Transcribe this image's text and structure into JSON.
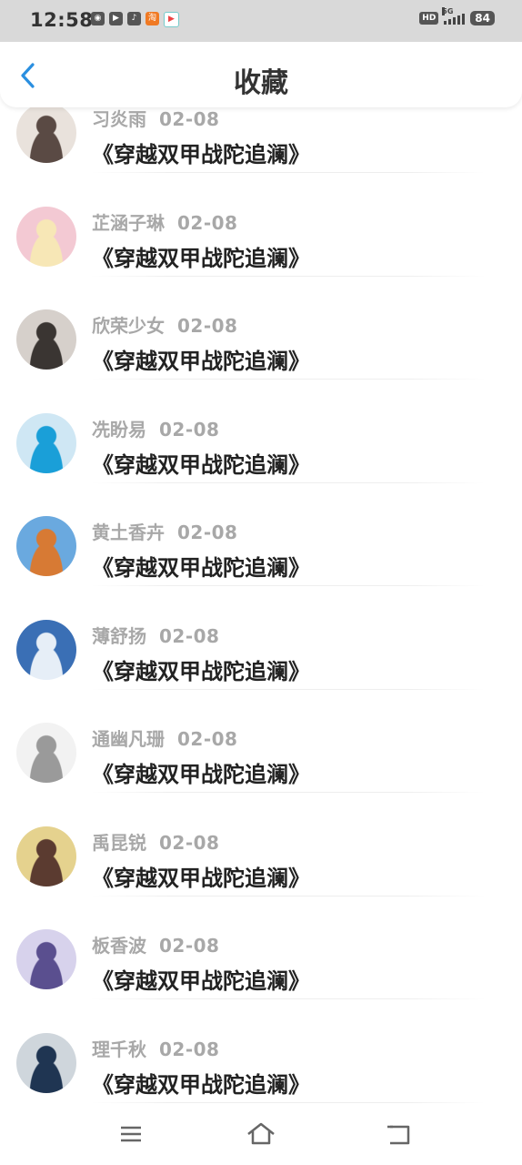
{
  "status_bar": {
    "time": "12:58",
    "app_icons": [
      "weibo-icon",
      "video-icon",
      "tiktok-icon",
      "taobao-icon",
      "play-icon"
    ],
    "hd_label": "HD",
    "network": "5G",
    "battery": "84"
  },
  "header": {
    "title": "收藏",
    "back_icon": "chevron-left-icon"
  },
  "items": [
    {
      "name": "习炎雨",
      "date": "02-08",
      "title": "《穿越双甲战陀追澜》",
      "avatar_colors": [
        "#e9e2dc",
        "#5a4a44"
      ]
    },
    {
      "name": "芷涵子琳",
      "date": "02-08",
      "title": "《穿越双甲战陀追澜》",
      "avatar_colors": [
        "#f3c9d3",
        "#f7e7b6"
      ]
    },
    {
      "name": "欣荣少女",
      "date": "02-08",
      "title": "《穿越双甲战陀追澜》",
      "avatar_colors": [
        "#d6d0cb",
        "#3a3532"
      ]
    },
    {
      "name": "冼盼易",
      "date": "02-08",
      "title": "《穿越双甲战陀追澜》",
      "avatar_colors": [
        "#cfe7f4",
        "#1a9fd8"
      ]
    },
    {
      "name": "黄土香卉",
      "date": "02-08",
      "title": "《穿越双甲战陀追澜》",
      "avatar_colors": [
        "#6aa9df",
        "#d77a34"
      ]
    },
    {
      "name": "薄舒扬",
      "date": "02-08",
      "title": "《穿越双甲战陀追澜》",
      "avatar_colors": [
        "#3a6fb5",
        "#e6eef7"
      ]
    },
    {
      "name": "通幽凡珊",
      "date": "02-08",
      "title": "《穿越双甲战陀追澜》",
      "avatar_colors": [
        "#f2f2f2",
        "#9a9a9a"
      ]
    },
    {
      "name": "禹昆锐",
      "date": "02-08",
      "title": "《穿越双甲战陀追澜》",
      "avatar_colors": [
        "#e5d28e",
        "#5b3b30"
      ]
    },
    {
      "name": "板香波",
      "date": "02-08",
      "title": "《穿越双甲战陀追澜》",
      "avatar_colors": [
        "#d7d2ec",
        "#5a4f8f"
      ]
    },
    {
      "name": "理千秋",
      "date": "02-08",
      "title": "《穿越双甲战陀追澜》",
      "avatar_colors": [
        "#cfd6dc",
        "#1f3552"
      ]
    }
  ],
  "nav_bar": {
    "menu_icon": "menu-icon",
    "home_icon": "home-icon",
    "back_icon": "back-icon"
  }
}
